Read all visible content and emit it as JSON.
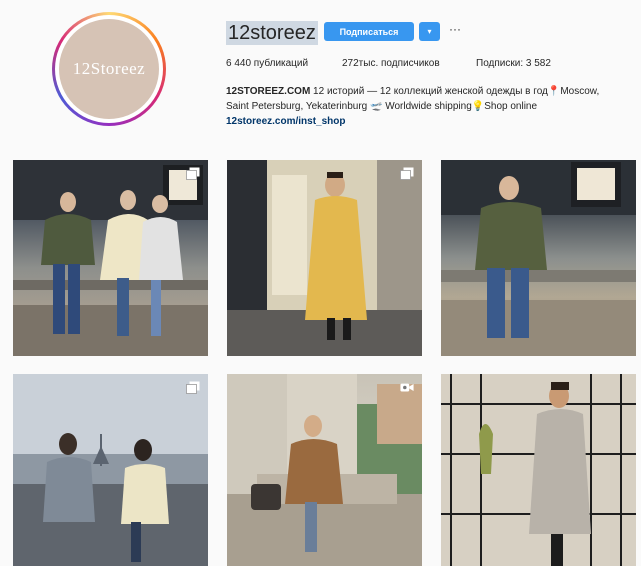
{
  "profile": {
    "avatar_logo_text": "12Storeez",
    "username": "12storeez",
    "follow_label": "Подписаться",
    "dropdown_glyph": "▾",
    "more_glyph": "···",
    "stats": {
      "posts": "6 440 публикаций",
      "followers": "272тыс. подписчиков",
      "following": "Подписки: 3 582"
    },
    "bio": {
      "name": "12STOREEZ.COM",
      "line1_text": " 12 историй — 12 коллекций женской одежды в год",
      "line1_tail": "Moscow,",
      "line2_text": "Saint Petersburg, Yekaterinburg",
      "line2_tail": " Worldwide shipping",
      "line2_end": "Shop online",
      "link": "12storeez.com/inst_shop"
    }
  },
  "icons": {
    "pin": "📍",
    "plane": "🛫",
    "bulb": "💡"
  },
  "posts": [
    {
      "kind": "carousel",
      "icon": "carousel-icon"
    },
    {
      "kind": "carousel",
      "icon": "carousel-icon"
    },
    {
      "kind": "image",
      "icon": ""
    },
    {
      "kind": "carousel",
      "icon": "carousel-icon"
    },
    {
      "kind": "video",
      "icon": "video-icon"
    },
    {
      "kind": "image",
      "icon": ""
    }
  ],
  "colors": {
    "accent": "#3897f0",
    "link": "#003569"
  }
}
